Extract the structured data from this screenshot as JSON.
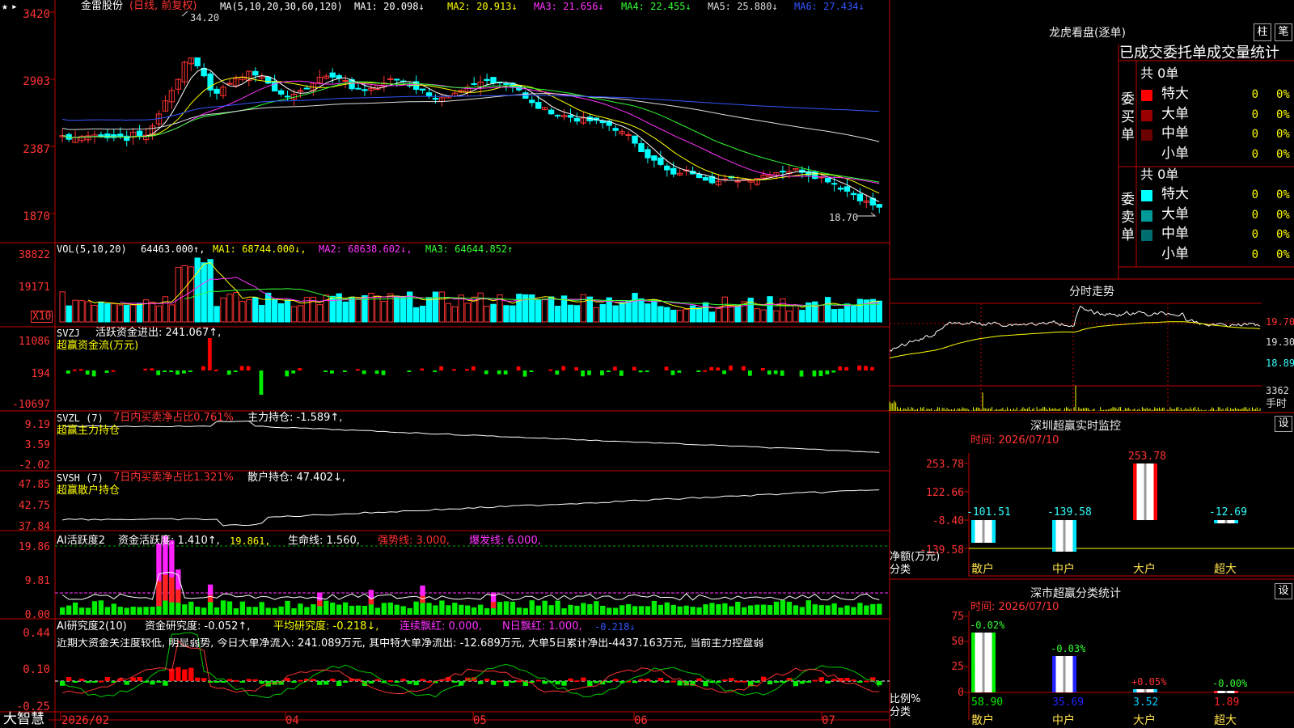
{
  "header": {
    "star": "★",
    "menu_arrow": "▸",
    "stock_name": "金雷股份",
    "period": "(日线, 前复权)",
    "ma_label": "MA(5,10,20,30,60,120)",
    "ma1": "MA1: 20.098↓",
    "ma2": "MA2: 20.913↓",
    "ma3": "MA3: 21.656↓",
    "ma4": "MA4: 22.455↓",
    "ma5": "MA5: 25.880↓",
    "ma6": "MA6: 27.434↓"
  },
  "main_chart": {
    "y_ticks": [
      "3420",
      "2903",
      "2387",
      "1870"
    ],
    "high_label": "34.20",
    "low_label": "18.70"
  },
  "vol_panel": {
    "title": "VOL(5,10,20)",
    "value": "64463.000↑,",
    "ma1": "MA1: 68744.000↓,",
    "ma2": "MA2: 68638.602↓,",
    "ma3": "MA3: 64644.852↑",
    "y_ticks": [
      "38822",
      "19171"
    ],
    "unit": "X10"
  },
  "svzj_panel": {
    "title": "SVZJ",
    "label": "活跃资金进出: 241.067↑,",
    "sub": "超赢资金流(万元)",
    "y_ticks": [
      "11086",
      "194",
      "-10697"
    ]
  },
  "svzl_panel": {
    "title": "SVZL (7)",
    "label1": "7日内买卖净占比0.761%",
    "label2": "主力持仓: -1.589↑,",
    "sub": "超赢主力持仓",
    "y_ticks": [
      "9.19",
      "3.59",
      "-2.02"
    ]
  },
  "svsh_panel": {
    "title": "SVSH (7)",
    "label1": "7日内买卖净占比1.321%",
    "label2": "散户持仓: 47.402↓,",
    "sub": "超赢散户持仓",
    "y_ticks": [
      "47.85",
      "42.75",
      "37.84"
    ]
  },
  "ai_active_panel": {
    "title": "AI活跃度2",
    "label1": "资金活跃度: 1.410↑,",
    "label2": "19.861,",
    "label3": "生命线: 1.560,",
    "label4": "强势线: 3.000,",
    "label5": "爆发线: 6.000,",
    "y_ticks": [
      "19.86",
      "9.81",
      "0.00"
    ]
  },
  "ai_research_panel": {
    "title": "AI研究度2(10)",
    "label1": "资金研究度: -0.052↑,",
    "label2": "平均研究度: -0.218↓,",
    "label3": "连续飘红: 0.000,",
    "label4": "N日飘红: 1.000,",
    "label5": "-0.218↓",
    "comment": "近期大资金关注度较低, 明显弱势, 今日大单净流入: 241.089万元, 其中特大单净流出: -12.689万元, 大单5日累计净出-4437.163万元, 当前主力控盘弱",
    "y_ticks": [
      "0.44",
      "0.10",
      "-0.25"
    ]
  },
  "bottom_bar": {
    "brand": "大智慧",
    "dates": [
      "2026/02",
      "04",
      "05",
      "06",
      "07"
    ]
  },
  "longhu": {
    "title": "龙虎看盘(逐单)",
    "btn_bar": "柱",
    "btn_pen": "笔",
    "subtitle": "已成交委托单成交量统计",
    "buy_side": "委买单",
    "sell_side": "委卖单",
    "buy_total": "共 0单",
    "sell_total": "共 0单",
    "rows": [
      {
        "name": "特大",
        "count": "0",
        "pct": "0%"
      },
      {
        "name": "大单",
        "count": "0",
        "pct": "0%"
      },
      {
        "name": "中单",
        "count": "0",
        "pct": "0%"
      },
      {
        "name": "小单",
        "count": "0",
        "pct": "0%"
      }
    ],
    "buy_colors": [
      "#ff0000",
      "#9a0000",
      "#6a0000",
      "#000000"
    ],
    "sell_colors": [
      "#00ffff",
      "#009a9a",
      "#006e6e",
      "#000000"
    ]
  },
  "intraday": {
    "title": "分时走势",
    "y_ticks": [
      "19.70",
      "19.30",
      "18.89"
    ],
    "vol_tick": "3362",
    "vol_unit": "手时"
  },
  "monitor": {
    "title": "深圳超赢实时监控",
    "btn": "设",
    "time": "时间: 2026/07/10",
    "y_ticks": [
      "253.78",
      "122.66",
      "-8.40",
      "-139.58"
    ],
    "ylabel": "净额(万元)",
    "xlabel": "分类",
    "categories": [
      "散户",
      "中户",
      "大户",
      "超大"
    ],
    "values": [
      -101.51,
      -139.58,
      253.78,
      -12.69
    ],
    "value_labels": [
      "-101.51",
      "-139.58",
      "253.78",
      "-12.69"
    ]
  },
  "classify": {
    "title": "深市超赢分类统计",
    "btn": "设",
    "time": "时间: 2026/07/10",
    "y_ticks": [
      "75",
      "50",
      "25",
      "0"
    ],
    "ylabel": "比例%",
    "xlabel": "分类",
    "categories": [
      "散户",
      "中户",
      "大户",
      "超大"
    ],
    "values": [
      58.9,
      35.69,
      3.52,
      1.89
    ],
    "value_labels": [
      "58.90",
      "35.69",
      "3.52",
      "1.89"
    ],
    "change_labels": [
      "-0.02%",
      "-0.03%",
      "+0.05%",
      "-0.00%"
    ]
  }
}
